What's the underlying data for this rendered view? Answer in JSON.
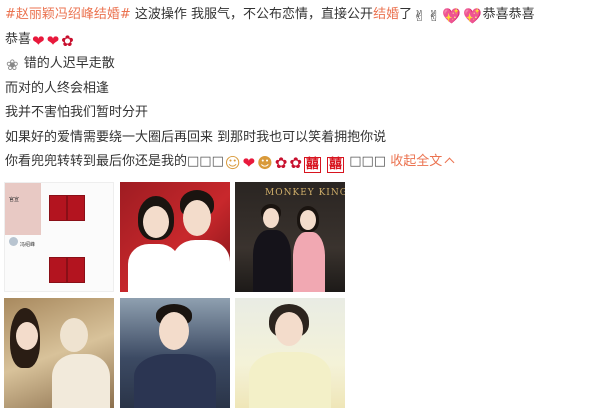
{
  "post": {
    "line1": {
      "topic": "#赵丽颖冯绍峰结婚#",
      "text_a": " 这波操作 我服气，不公布恋情，直接公开",
      "link": "结婚",
      "text_b": "了",
      "text_c": "恭喜恭喜"
    },
    "line2": {
      "text": "恭喜"
    },
    "line3": {
      "text": " 错的人迟早走散"
    },
    "line4": {
      "text": "而对的人终会相逢"
    },
    "line5": {
      "text": "我并不害怕我们暂时分开"
    },
    "line6": {
      "text": "如果好的爱情需要绕一大圈后再回来 到那时我也可以笑着拥抱你说"
    },
    "line7": {
      "text": "你看兜兜转转到最后你还是我的",
      "boxes1": "□□□",
      "xi": "囍",
      "boxes2": " □□□",
      "expand": "收起全文"
    }
  },
  "images": {
    "mini_name_1": "官宣",
    "mini_name_2": "冯绍峰",
    "poster_sign": "MONKEY KING"
  },
  "icons": {
    "heart": "red-heart",
    "rose": "rose",
    "flower": "white-flower",
    "gesture": "hand-gesture",
    "sparkle_heart": "sparkling-heart",
    "kiss": "kiss-face",
    "double_happiness": "double-happiness",
    "caret": "chevron-up"
  },
  "colors": {
    "link": "#eb7350",
    "text": "#333333",
    "heart": "#e8193c",
    "xi": "#d8141f"
  }
}
